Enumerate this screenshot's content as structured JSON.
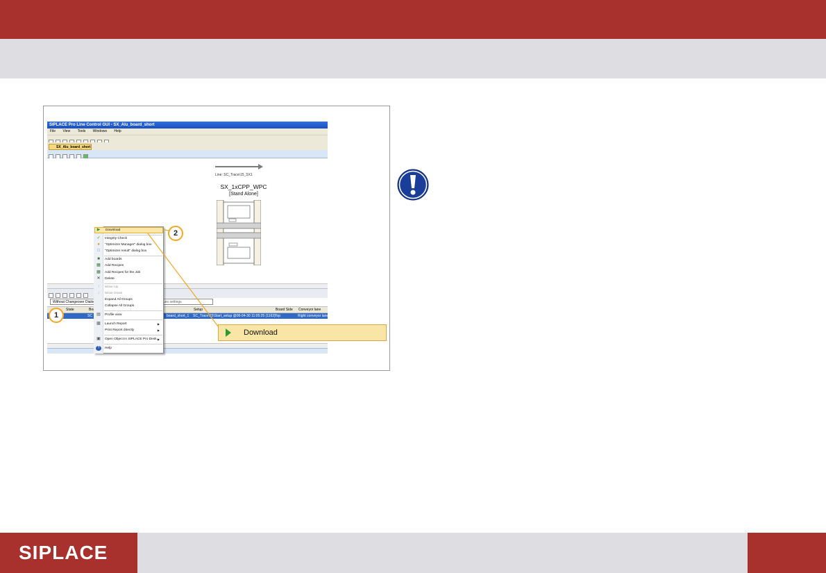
{
  "brand": {
    "logo_text": "SIPLACE",
    "colors": {
      "primary": "#a8302d",
      "secondary": "#dedde1"
    }
  },
  "window": {
    "title": "SIPLACE Pro Line Control GUI - SX_Alu_board_short",
    "menu": [
      "File",
      "View",
      "Tools",
      "Windows",
      "Help"
    ],
    "tab_label": "SX_Alu_board_short"
  },
  "line_view": {
    "line_label": "Line: SC_Trace\\15_SX1",
    "machine_title": "SX_1xCPP_WPC",
    "machine_subtitle": "[Stand Alone]"
  },
  "lower_panel": {
    "mode_label": "Without Changeover Dialog",
    "filter_placeholder": "ues settings",
    "columns": [
      "State",
      "Boa",
      "Setup",
      "Board Side",
      "Conveyor lane"
    ],
    "row": {
      "state": "SC",
      "board": "board_short_1",
      "setup": "SC_Trace\\15\\Start_setup @06-04-30 11:05:25 (1163)",
      "board_side": "Top",
      "conveyor_lane": "Right conveyor lane"
    }
  },
  "context_menu": {
    "items": [
      {
        "label": "Download",
        "icon": "green-play-icon",
        "highlighted": true
      },
      {
        "label": "Integrity Check",
        "icon": "checkmark-icon"
      },
      {
        "label": "\"Optimizer Manager\" dialog box",
        "icon": "optimizer-icon"
      },
      {
        "label": "\"Optimizer result\" dialog box",
        "icon": "result-icon"
      },
      {
        "label": "Add boards",
        "icon": "board-icon"
      },
      {
        "label": "Add Recipes",
        "icon": "recipe-icon"
      },
      {
        "label": "Add Recipes for the Job",
        "icon": "recipe-job-icon"
      },
      {
        "label": "Delete",
        "icon": "delete-icon"
      },
      {
        "label": "Move Up",
        "icon": "move-up-icon",
        "disabled": true
      },
      {
        "label": "Move Down",
        "icon": "move-down-icon",
        "disabled": true
      },
      {
        "label": "Expand All Groups"
      },
      {
        "label": "Collapse All Groups"
      },
      {
        "label": "Profile view",
        "icon": "profile-icon"
      },
      {
        "label": "Launch Report",
        "icon": "report-icon",
        "submenu": true
      },
      {
        "label": "Print Report directly",
        "submenu": true
      },
      {
        "label": "Open Object in SIPLACE Pro Desk",
        "icon": "open-icon",
        "submenu": true
      },
      {
        "label": "Help",
        "icon": "help-icon"
      }
    ]
  },
  "callouts": {
    "step1": "1",
    "step2": "2",
    "download_label": "Download"
  },
  "notice": {
    "icon": "exclamation-icon",
    "color": "#1b3d9a"
  }
}
